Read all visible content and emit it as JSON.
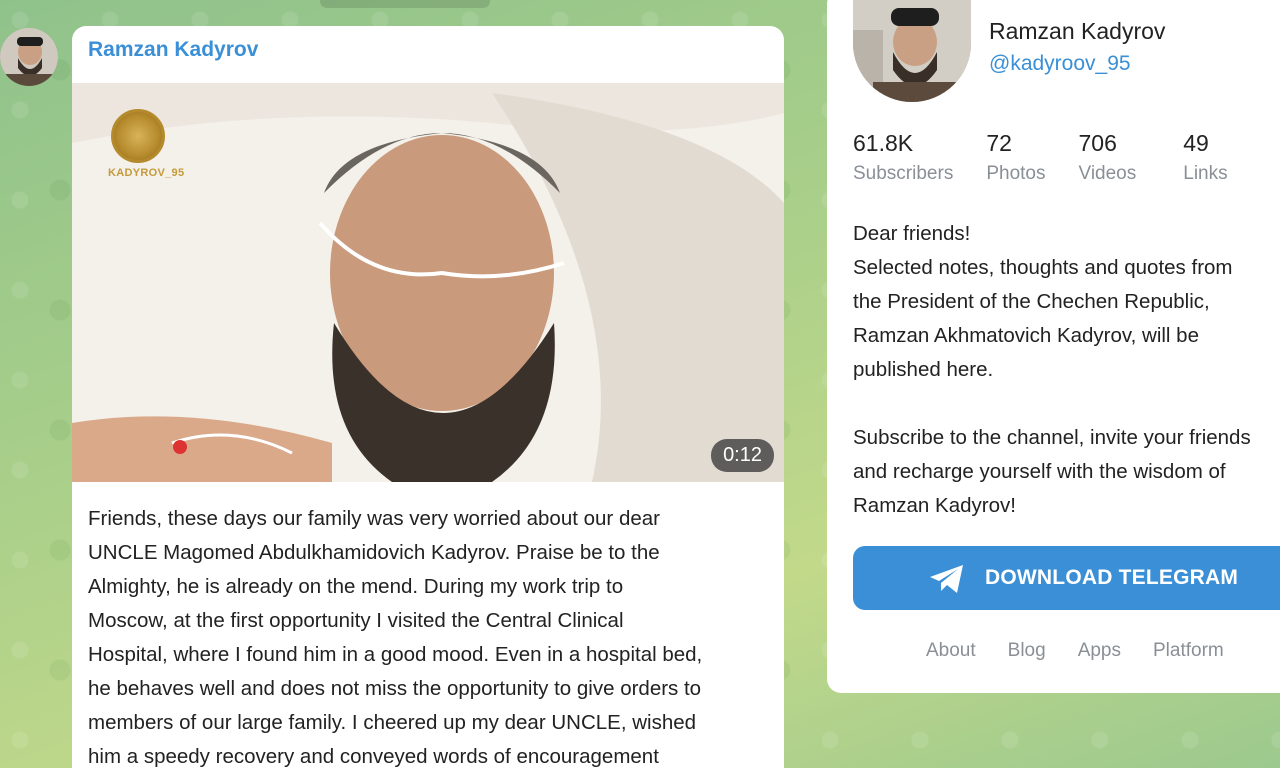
{
  "post": {
    "author": "Ramzan Kadyrov",
    "media": {
      "watermark_text": "KADYROV_95",
      "duration": "0:12"
    },
    "text_lines": [
      "Friends, these days our family was very worried about our dear",
      "UNCLE Magomed Abdulkhamidovich Kadyrov. Praise be to the",
      "Almighty, he is already on the mend. During my work trip to",
      "Moscow, at the first opportunity I visited the Central Clinical",
      "Hospital, where I found him in a good mood. Even in a hospital bed,",
      "he behaves well and does not miss the opportunity to give orders to",
      "members of our large family. I cheered up my dear UNCLE, wished",
      "him a speedy recovery and conveyed words of encouragement"
    ]
  },
  "channel": {
    "name": "Ramzan Kadyrov",
    "handle": "@kadyroov_95",
    "stats": [
      {
        "value": "61.8K",
        "label": "Subscribers"
      },
      {
        "value": "72",
        "label": "Photos"
      },
      {
        "value": "706",
        "label": "Videos"
      },
      {
        "value": "49",
        "label": "Links"
      }
    ],
    "description_lines": [
      "Dear friends!",
      "Selected notes, thoughts and quotes from",
      "the President of the Chechen Republic,",
      "Ramzan Akhmatovich Kadyrov, will be",
      "published here.",
      "",
      "Subscribe to the channel, invite your friends",
      "and recharge yourself with the wisdom of",
      "Ramzan Kadyrov!"
    ],
    "download_label": "DOWNLOAD TELEGRAM",
    "footer_links": [
      "About",
      "Blog",
      "Apps",
      "Platform"
    ]
  },
  "colors": {
    "accent": "#3a8fd6",
    "muted_text": "#8a8f96",
    "background": "#a9cf8a"
  }
}
